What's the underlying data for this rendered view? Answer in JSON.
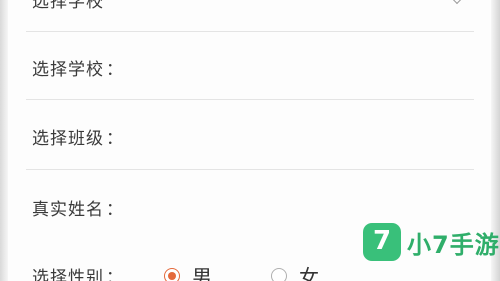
{
  "form": {
    "top_row_label": "选择学校",
    "fields": [
      {
        "label": "选择学校",
        "colon": "："
      },
      {
        "label": "选择班级",
        "colon": "："
      },
      {
        "label": "真实姓名",
        "colon": "："
      },
      {
        "label": "选择性别",
        "colon": "："
      }
    ],
    "gender": {
      "options": [
        "男",
        "女"
      ],
      "selected": "男"
    }
  },
  "watermark": {
    "logo_glyph": "7",
    "text": "小7手游"
  },
  "colors": {
    "accent": "#e46a3c",
    "watermark_green": "#39c07a"
  },
  "icons": [
    "chevron-down-icon",
    "radio-checked-icon",
    "radio-unchecked-icon",
    "logo-icon"
  ]
}
